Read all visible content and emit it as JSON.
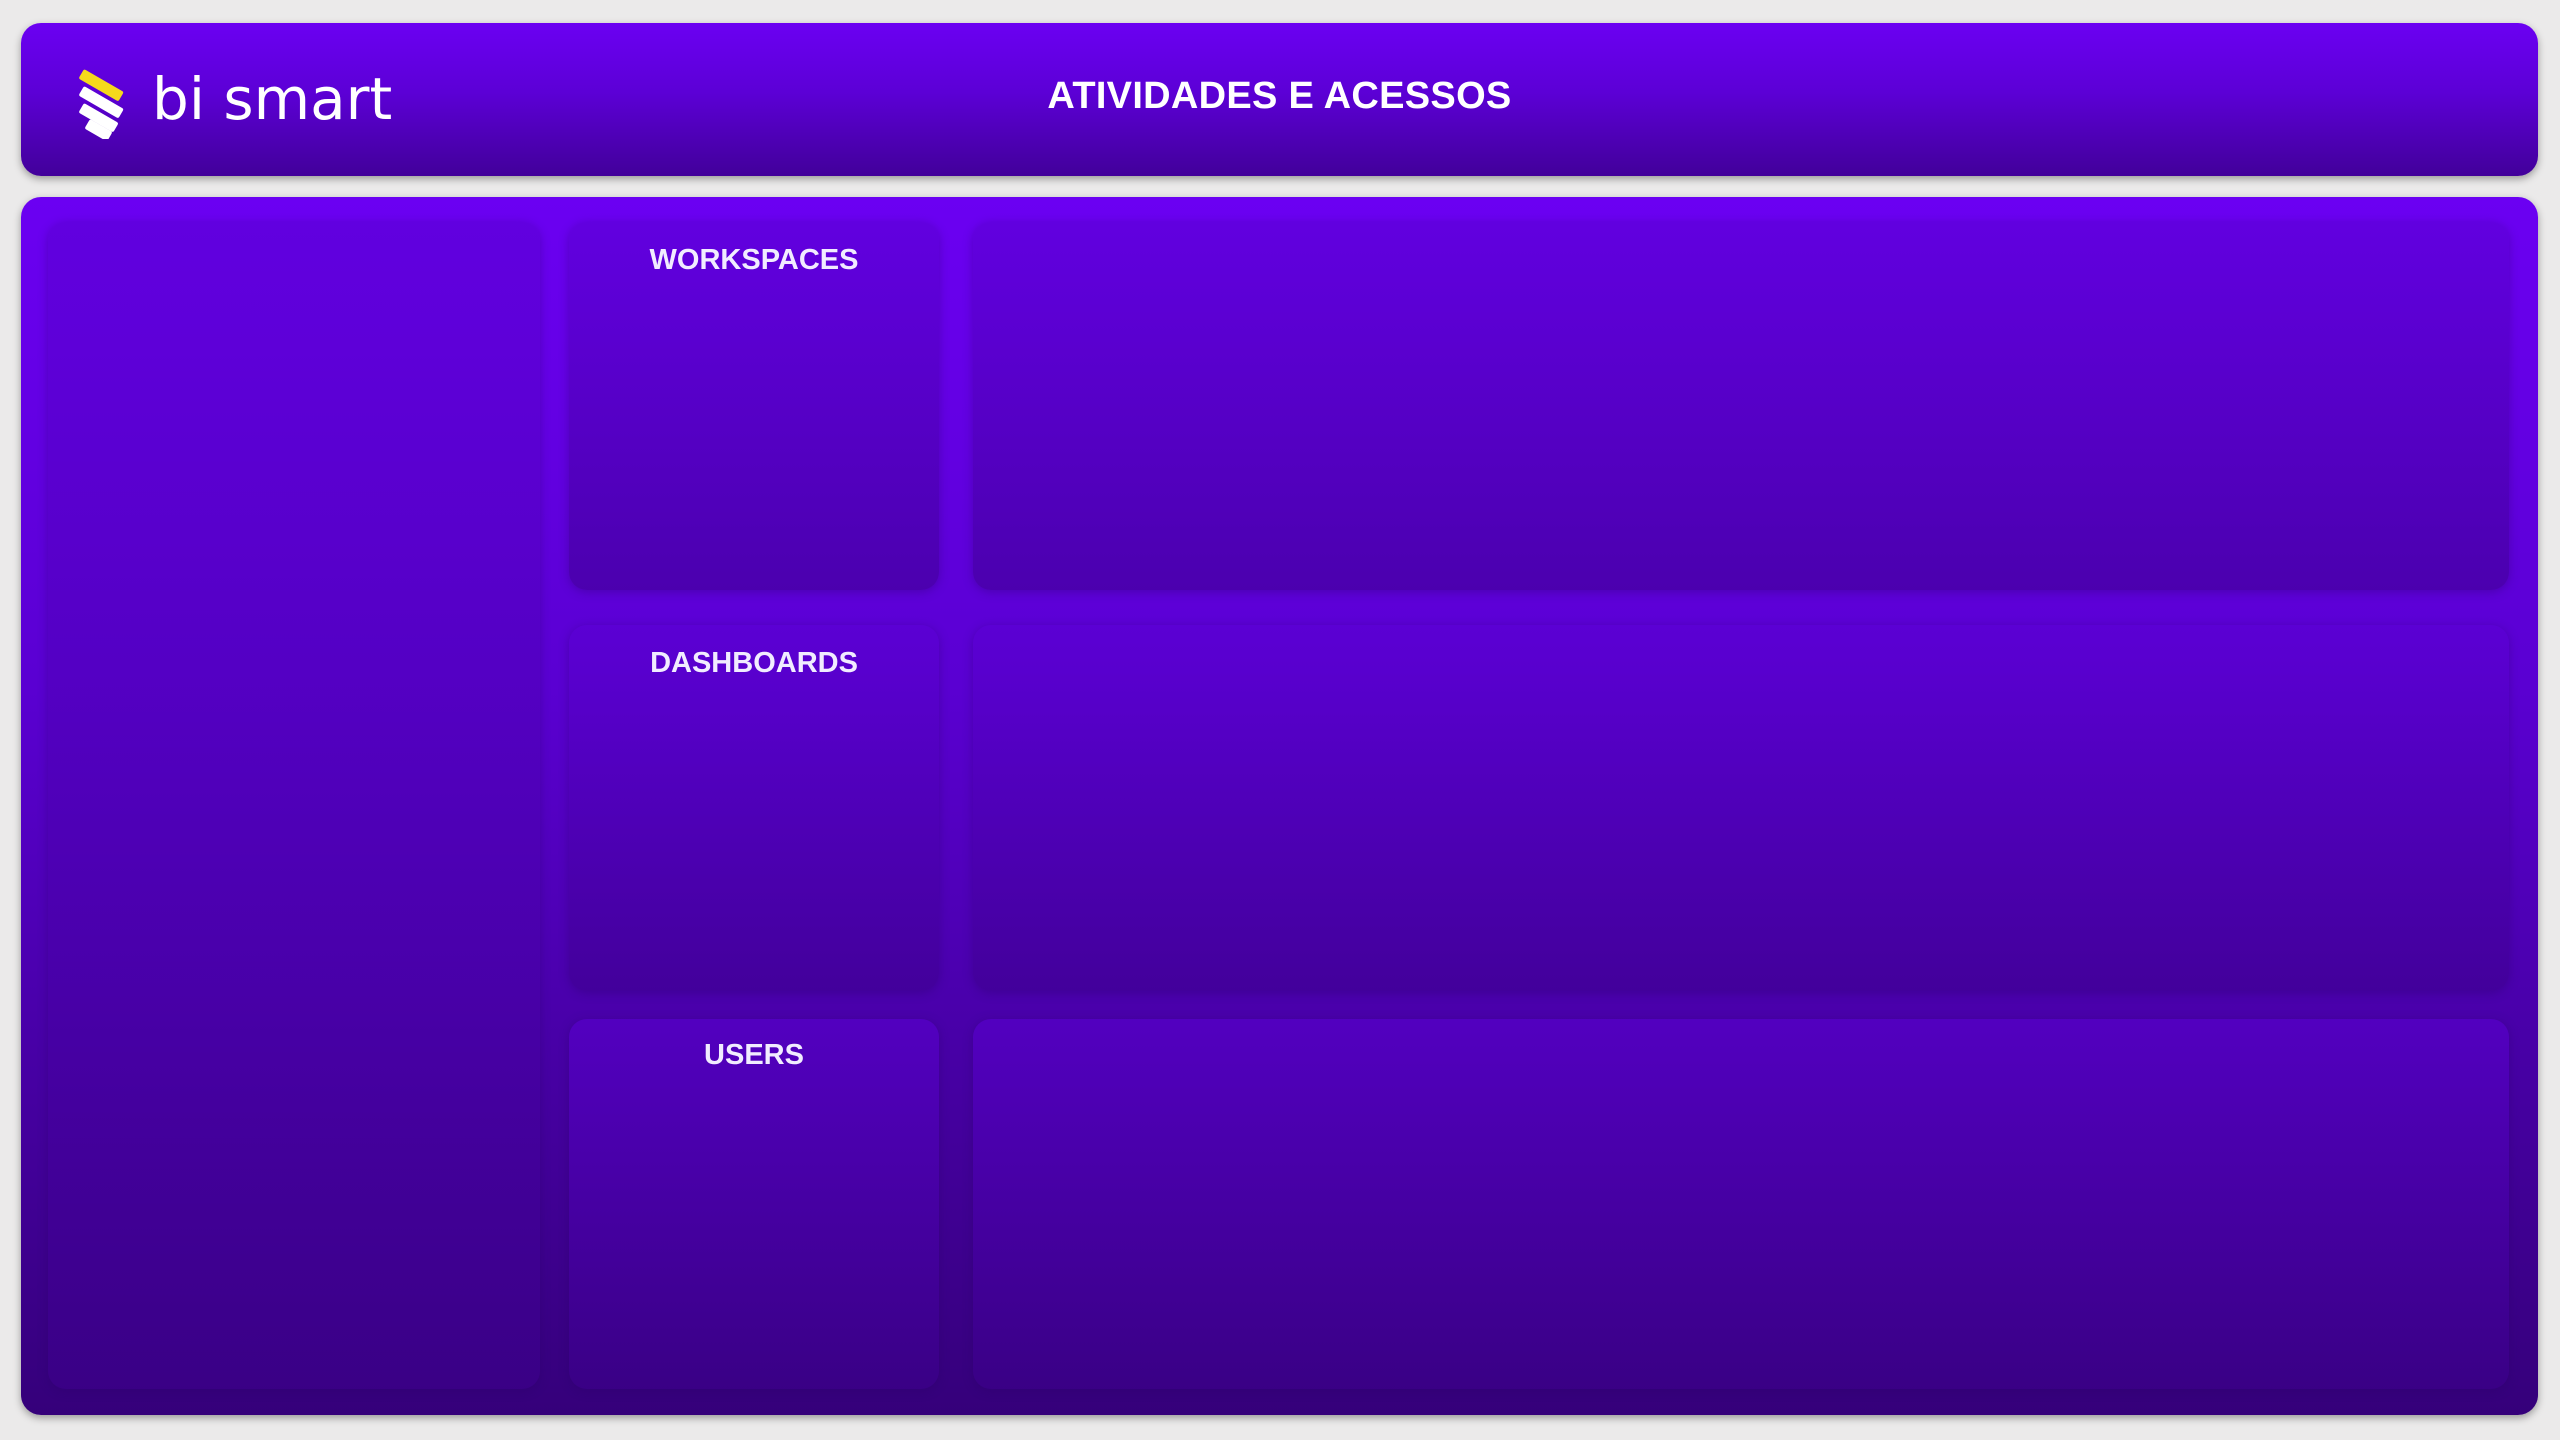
{
  "header": {
    "logo_text": "bi smart",
    "title": "ATIVIDADES E ACESSOS"
  },
  "kpis": [
    {
      "label": "WORKSPACES"
    },
    {
      "label": "DASHBOARDS"
    },
    {
      "label": "USERS"
    }
  ],
  "colors": {
    "brand_purple": "#6b00f2",
    "brand_purple_dark": "#35007a",
    "logo_accent": "#f5d91c",
    "background": "#ebeaea"
  },
  "icons": {
    "logo": "bi-smart-logo-icon"
  }
}
